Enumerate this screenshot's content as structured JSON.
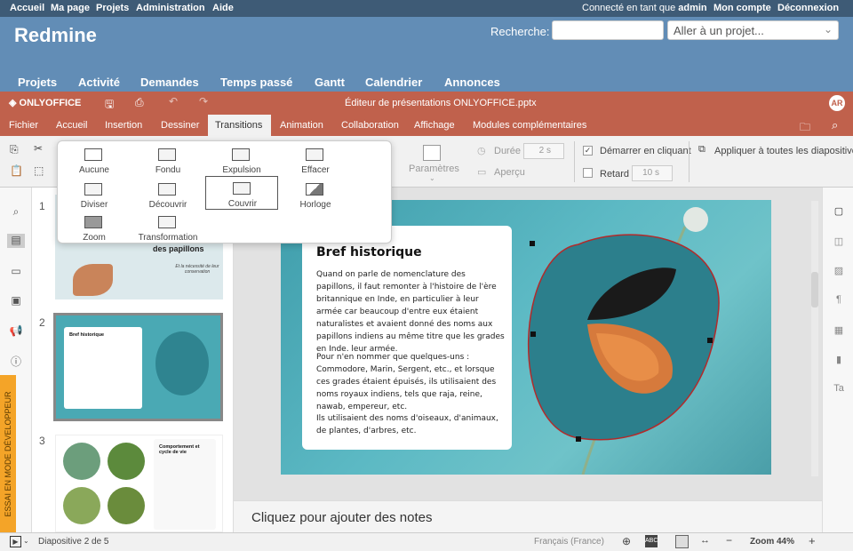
{
  "redmine": {
    "topbar": {
      "left_links": [
        "Accueil",
        "Ma page",
        "Projets",
        "Administration",
        "Aide"
      ],
      "logged_prefix": "Connecté en tant que ",
      "user": "admin",
      "account": "Mon compte",
      "logout": "Déconnexion"
    },
    "title": "Redmine",
    "search_label": "Recherche:",
    "search_value": "",
    "jump_placeholder": "Aller à un projet...",
    "menu": [
      "Projets",
      "Activité",
      "Demandes",
      "Temps passé",
      "Gantt",
      "Calendrier",
      "Annonces"
    ]
  },
  "oo": {
    "logo": "ONLYOFFICE",
    "doc_title": "Éditeur de présentations ONLYOFFICE.pptx",
    "avatar": "AR",
    "tabs": [
      "Fichier",
      "Accueil",
      "Insertion",
      "Dessiner",
      "Transitions",
      "Animation",
      "Collaboration",
      "Affichage",
      "Modules complémentaires"
    ],
    "active_tab": "Transitions"
  },
  "toolbar": {
    "params": "Paramètres",
    "duration_label": "Durée",
    "duration_value": "2 s",
    "preview": "Aperçu",
    "start_on_click": "Démarrer en cliquant",
    "start_on_click_checked": true,
    "delay_label": "Retard",
    "delay_value": "10 s",
    "delay_checked": false,
    "apply_all": "Appliquer à toutes les diapositives"
  },
  "transitions": {
    "items": [
      "Aucune",
      "Fondu",
      "Expulsion",
      "Effacer",
      "Diviser",
      "Découvrir",
      "Couvrir",
      "Horloge",
      "Zoom",
      "Transformation"
    ],
    "selected": "Couvrir"
  },
  "thumbs": {
    "numbers": [
      "1",
      "2",
      "3"
    ],
    "slide1_title": "des papillons",
    "slide1_sub": "Et la nécessité de leur conservation",
    "slide2_title": "Bref historique",
    "slide3_title": "Comportement et cycle de vie"
  },
  "slide": {
    "title": "Bref historique",
    "p1": "Quand on parle de nomenclature des papillons, il faut remonter à l'histoire de l'ère britannique en Inde, en particulier à leur armée car beaucoup d'entre eux étaient naturalistes et avaient donné des noms aux papillons indiens au même titre que les grades en Inde. leur armée.",
    "p2": "Pour n'en nommer que quelques-uns : Commodore, Marin, Sergent, etc., et lorsque ces grades étaient épuisés, ils utilisaient des noms royaux indiens, tels que raja, reine, nawab, empereur, etc.",
    "p3": "Ils utilisaient des noms d'oiseaux, d'animaux, de plantes, d'arbres, etc."
  },
  "notes_placeholder": "Cliquez pour ajouter des notes",
  "dev_banner": "ESSAI EN MODE DÉVELOPPEUR",
  "status": {
    "slide_info": "Diapositive 2 de 5",
    "language": "Français (France)",
    "zoom": "Zoom 44%"
  },
  "colors": {
    "redmine_top": "#3e5b76",
    "redmine_header": "#628db6",
    "oo_accent": "#c0614c",
    "dev_banner": "#f4a428"
  }
}
